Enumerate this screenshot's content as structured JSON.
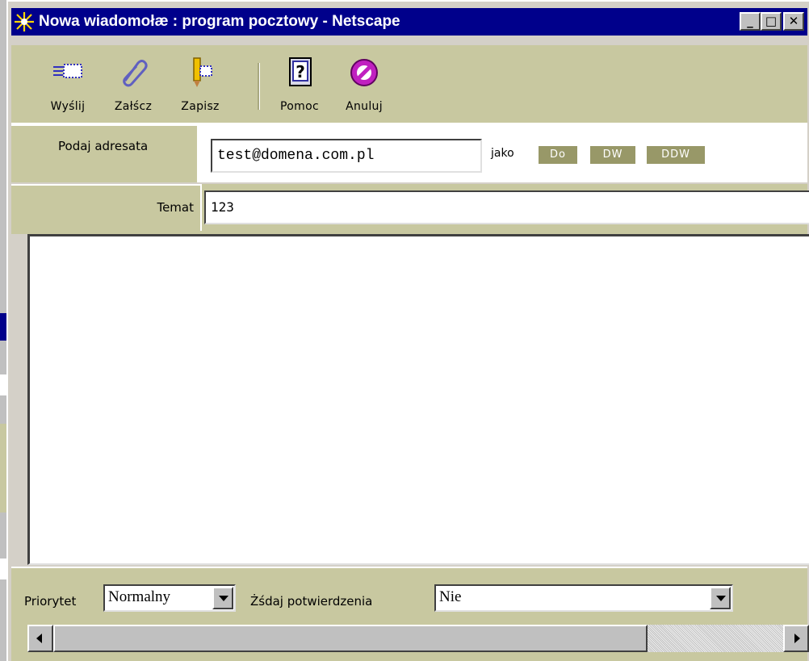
{
  "window": {
    "title": "Nowa wiadomołæ : program pocztowy - Netscape"
  },
  "toolbar": {
    "send": "Wyślij",
    "attach": "Załścz",
    "save": "Zapisz",
    "help": "Pomoc",
    "cancel": "Anuluj"
  },
  "recipient": {
    "label": "Podaj adresata",
    "value": "test@domena.com.pl",
    "as_label": "jako",
    "types": [
      "Do",
      "DW",
      "DDW"
    ]
  },
  "subject": {
    "label": "Temat",
    "value": "123"
  },
  "options": {
    "priority_label": "Priorytet",
    "priority_value": "Normalny",
    "confirm_label": "Żśdaj potwierdzenia",
    "confirm_value": "Nie"
  },
  "icons": {
    "app": "netscape-star-icon",
    "send": "envelope-send-icon",
    "attach": "paperclip-icon",
    "save": "pencil-save-icon",
    "help": "help-book-icon",
    "cancel": "no-entry-icon"
  },
  "colors": {
    "titlebar": "#00008b",
    "panel": "#c8c8a0",
    "pill": "#989868"
  }
}
